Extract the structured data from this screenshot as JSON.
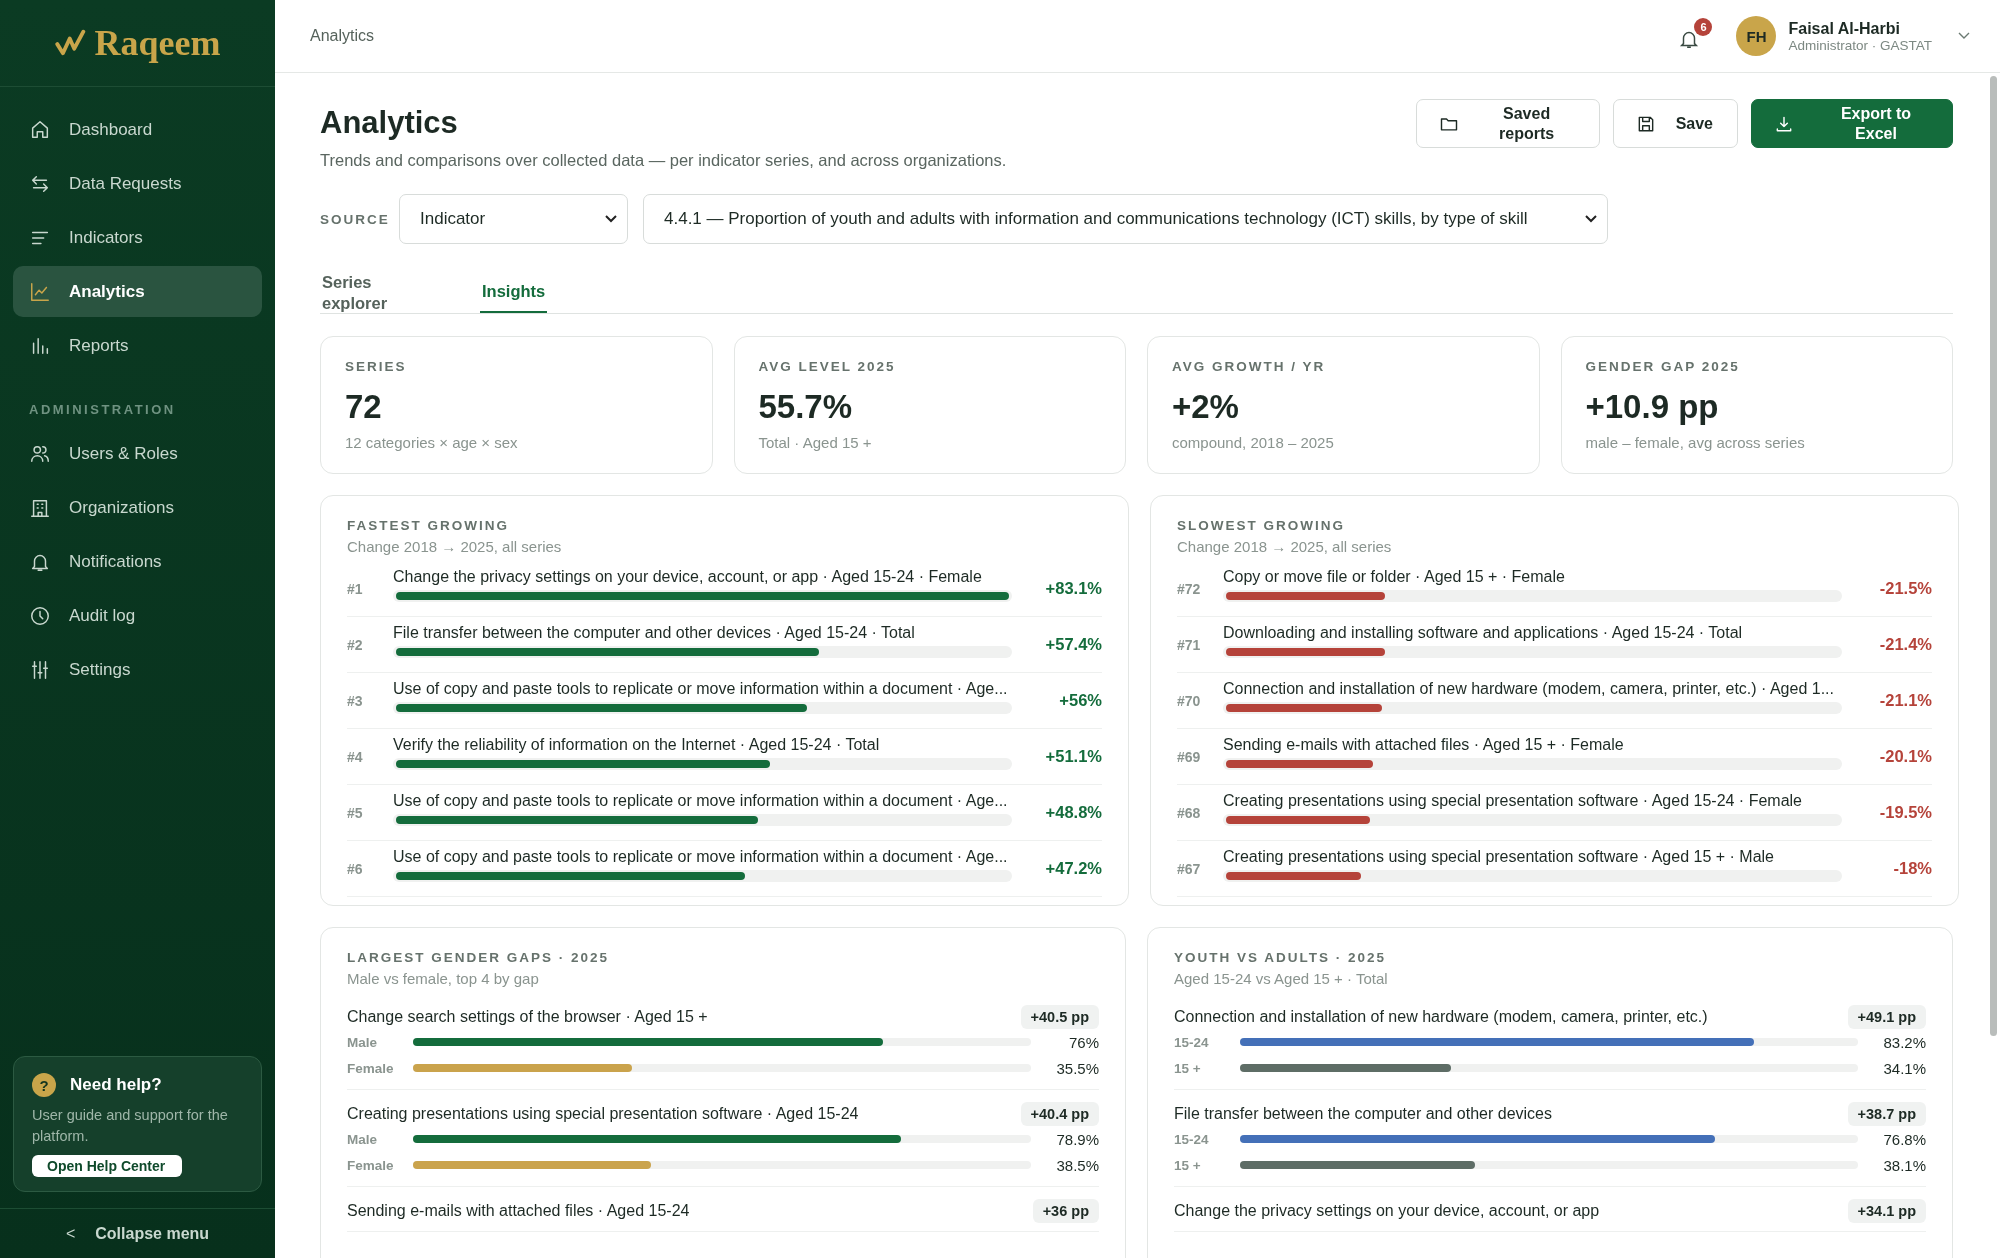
{
  "sidebar": {
    "logo": "Raqeem",
    "items": [
      {
        "label": "Dashboard",
        "selected": false
      },
      {
        "label": "Data Requests",
        "selected": false
      },
      {
        "label": "Indicators",
        "selected": false
      },
      {
        "label": "Analytics",
        "selected": true
      },
      {
        "label": "Reports",
        "selected": false
      }
    ],
    "section": "ADMINISTRATION",
    "admin_items": [
      {
        "label": "Users & Roles",
        "selected": false
      },
      {
        "label": "Organizations",
        "selected": false
      },
      {
        "label": "Notifications",
        "selected": false
      },
      {
        "label": "Audit log",
        "selected": false
      },
      {
        "label": "Settings",
        "selected": false
      }
    ],
    "help": {
      "mark": "?",
      "title": "Need help?",
      "text": "User guide and support for the platform.",
      "button": "Open Help Center"
    },
    "collapse": {
      "arrow": "<",
      "label": "Collapse menu"
    }
  },
  "topbar": {
    "breadcrumb": "Analytics",
    "notifications": "6",
    "user": {
      "initials": "FH",
      "name": "Faisal Al-Harbi",
      "role": "Administrator · GASTAT"
    }
  },
  "page": {
    "title": "Analytics",
    "subtitle": "Trends and comparisons over collected data — per indicator series, and across organizations.",
    "buttons": [
      {
        "label": "Saved reports",
        "kind": "folder"
      },
      {
        "label": "Save",
        "kind": "save"
      },
      {
        "label": "Export to Excel",
        "kind": "export"
      }
    ]
  },
  "source": {
    "label": "SOURCE",
    "type": "Indicator",
    "indicator": "4.4.1 — Proportion of youth and adults with information and communications technology (ICT) skills, by type of skill"
  },
  "tabs": [
    {
      "label": "Series explorer",
      "selected": false
    },
    {
      "label": "Insights",
      "selected": true
    }
  ],
  "stats": [
    {
      "label": "SERIES",
      "value": "72",
      "note": "12 categories × age × sex"
    },
    {
      "label": "AVG LEVEL 2025",
      "value": "55.7%",
      "note": "Total · Aged 15 +"
    },
    {
      "label": "AVG GROWTH / YR",
      "value": "+2%",
      "note": "compound, 2018 – 2025"
    },
    {
      "label": "GENDER GAP 2025",
      "value": "+10.9 pp",
      "note": "male – female, avg across series"
    }
  ],
  "rankings": [
    {
      "title": "FASTEST GROWING",
      "subtitle": "Change 2018 → 2025, all series",
      "rows": [
        {
          "rank": "#1",
          "label": "Change the privacy settings on your device, account, or app · Aged 15-24 · Female",
          "value": "+83.1%",
          "level": 1.0
        },
        {
          "rank": "#2",
          "label": "File transfer between the computer and other devices · Aged 15-24 · Total",
          "value": "+57.4%",
          "level": 0.69
        },
        {
          "rank": "#3",
          "label": "Use of copy and paste tools to replicate or move information within a document · Age...",
          "value": "+56%",
          "level": 0.67
        },
        {
          "rank": "#4",
          "label": "Verify the reliability of information on the Internet · Aged 15-24 · Total",
          "value": "+51.1%",
          "level": 0.61
        },
        {
          "rank": "#5",
          "label": "Use of copy and paste tools to replicate or move information within a document · Age...",
          "value": "+48.8%",
          "level": 0.59
        },
        {
          "rank": "#6",
          "label": "Use of copy and paste tools to replicate or move information within a document · Age...",
          "value": "+47.2%",
          "level": 0.57
        }
      ]
    },
    {
      "title": "SLOWEST GROWING",
      "subtitle": "Change 2018 → 2025, all series",
      "rows": [
        {
          "rank": "#72",
          "label": "Copy or move file or folder · Aged 15 + · Female",
          "value": "-21.5%",
          "level": 0.26
        },
        {
          "rank": "#71",
          "label": "Downloading and installing software and applications · Aged 15-24 · Total",
          "value": "-21.4%",
          "level": 0.26
        },
        {
          "rank": "#70",
          "label": "Connection and installation of new hardware (modem, camera, printer, etc.) · Aged 1...",
          "value": "-21.1%",
          "level": 0.255
        },
        {
          "rank": "#69",
          "label": "Sending e-mails with attached files · Aged 15 + · Female",
          "value": "-20.1%",
          "level": 0.24
        },
        {
          "rank": "#68",
          "label": "Creating presentations using special presentation software · Aged 15-24 · Female",
          "value": "-19.5%",
          "level": 0.235
        },
        {
          "rank": "#67",
          "label": "Creating presentations using special presentation software · Aged 15 + · Male",
          "value": "-18%",
          "level": 0.22
        }
      ]
    }
  ],
  "comparisons": [
    {
      "title": "LARGEST GENDER GAPS · 2025",
      "subtitle": "Male vs female, top 4 by gap",
      "rows": [
        {
          "label": "Change search settings of the browser · Aged 15 +",
          "gap": "+40.5 pp",
          "bars": [
            {
              "name": "Male",
              "kind": "primary",
              "level": 0.76,
              "value": "76%"
            },
            {
              "name": "Female",
              "kind": "secondary",
              "level": 0.355,
              "value": "35.5%"
            }
          ]
        },
        {
          "label": "Creating presentations using special presentation software · Aged 15-24",
          "gap": "+40.4 pp",
          "bars": [
            {
              "name": "Male",
              "kind": "primary",
              "level": 0.789,
              "value": "78.9%"
            },
            {
              "name": "Female",
              "kind": "secondary",
              "level": 0.385,
              "value": "38.5%"
            }
          ]
        },
        {
          "label": "Sending e-mails with attached files · Aged 15-24",
          "gap": "+36 pp"
        }
      ]
    },
    {
      "title": "YOUTH VS ADULTS · 2025",
      "subtitle": "Aged 15-24 vs Aged 15 + · Total",
      "rows": [
        {
          "label": "Connection and installation of new hardware (modem, camera, printer, etc.)",
          "gap": "+49.1 pp",
          "bars": [
            {
              "name": "15-24",
              "kind": "primary",
              "level": 0.832,
              "value": "83.2%"
            },
            {
              "name": "15 +",
              "kind": "secondary",
              "level": 0.341,
              "value": "34.1%"
            }
          ]
        },
        {
          "label": "File transfer between the computer and other devices",
          "gap": "+38.7 pp",
          "bars": [
            {
              "name": "15-24",
              "kind": "primary",
              "level": 0.768,
              "value": "76.8%"
            },
            {
              "name": "15 +",
              "kind": "secondary",
              "level": 0.381,
              "value": "38.1%"
            }
          ]
        },
        {
          "label": "Change the privacy settings on your device, account, or app",
          "gap": "+34.1 pp"
        }
      ]
    }
  ]
}
